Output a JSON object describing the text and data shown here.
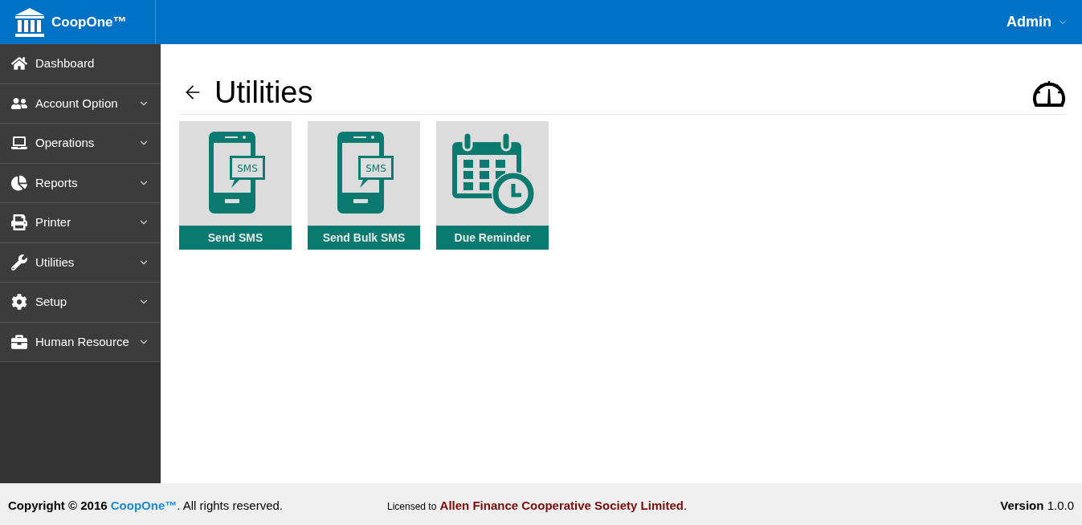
{
  "header": {
    "brand": "CoopOne™",
    "user": "Admin"
  },
  "sidebar": {
    "items": [
      {
        "label": "Dashboard",
        "expandable": false
      },
      {
        "label": "Account Option",
        "expandable": true
      },
      {
        "label": "Operations",
        "expandable": true
      },
      {
        "label": "Reports",
        "expandable": true
      },
      {
        "label": "Printer",
        "expandable": true
      },
      {
        "label": "Utilities",
        "expandable": true
      },
      {
        "label": "Setup",
        "expandable": true
      },
      {
        "label": "Human Resource",
        "expandable": true
      }
    ]
  },
  "page": {
    "title": "Utilities"
  },
  "tiles": [
    {
      "kind": "phone",
      "icon_text": "SMS",
      "label": "Send SMS"
    },
    {
      "kind": "phone",
      "icon_text": "SMS",
      "label": "Send Bulk SMS"
    },
    {
      "kind": "calendar",
      "label": "Due Reminder"
    }
  ],
  "footer": {
    "copyright": {
      "prefix": "Copyright © 2016",
      "brand": "CoopOne™",
      "suffix": ". All rights reserved."
    },
    "license": {
      "prefix": "Licensed to",
      "org": "Allen Finance Cooperative Society Limited",
      "suffix": "."
    },
    "version": {
      "label": "Version",
      "value": "1.0.0"
    }
  }
}
